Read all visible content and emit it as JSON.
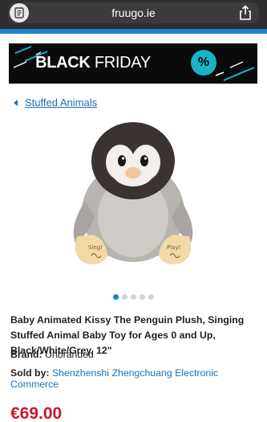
{
  "browser": {
    "url": "fruugo.ie"
  },
  "banner": {
    "word_bold": "BLACK",
    "word_thin": "FRIDAY",
    "badge": "%"
  },
  "breadcrumb": {
    "label": "Stuffed Animals"
  },
  "gallery": {
    "image_count": 5,
    "active_index": 0
  },
  "product": {
    "title": "Baby Animated Kissy The Penguin Plush, Singing Stuffed Animal Baby Toy for Ages 0 and Up, Black/White/Grey, 12\"",
    "brand_key": "Brand:",
    "brand_value": "Unbranded",
    "seller_key": "Sold by:",
    "seller_value": "Shenzhenshi Zhengchuang Electronic Commerce",
    "price": "€69.00",
    "feet_text_left": "Sing!",
    "feet_text_right": "Play!"
  },
  "colors": {
    "accent": "#1a86d0",
    "link": "#1f6fb3",
    "price": "#c8182e",
    "badge": "#19b3c6"
  }
}
